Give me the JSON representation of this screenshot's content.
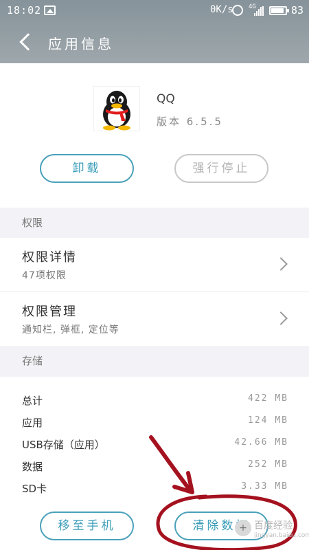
{
  "status_bar": {
    "time": "18:02",
    "speed": "0K/s",
    "network": "4G",
    "battery": "83"
  },
  "header": {
    "title": "应用信息"
  },
  "app": {
    "name": "QQ",
    "version": "版本 6.5.5"
  },
  "actions": {
    "uninstall_label": "卸载",
    "force_stop_label": "强行停止"
  },
  "permissions": {
    "section_label": "权限",
    "items": [
      {
        "title": "权限详情",
        "subtitle": "47项权限"
      },
      {
        "title": "权限管理",
        "subtitle": "通知栏, 弹框, 定位等"
      }
    ]
  },
  "storage": {
    "section_label": "存储",
    "rows": [
      {
        "label": "总计",
        "value": "422 MB"
      },
      {
        "label": "应用",
        "value": "124 MB"
      },
      {
        "label": "USB存储（应用）",
        "value": "42.66 MB"
      },
      {
        "label": "数据",
        "value": "252 MB"
      },
      {
        "label": "SD卡",
        "value": "3.33 MB"
      }
    ],
    "move_label": "移至手机",
    "clear_label": "清除数据"
  },
  "annotation_color": "#a5121f",
  "watermark": {
    "badge": "+",
    "line1": "百度经验",
    "line2": "jingyan.baidu.com"
  }
}
